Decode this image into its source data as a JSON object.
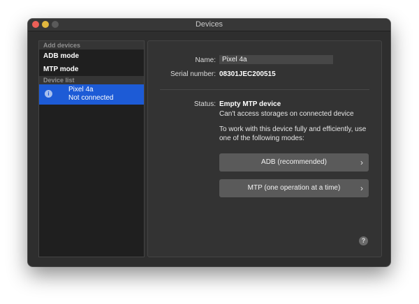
{
  "window": {
    "title": "Devices"
  },
  "sidebar": {
    "add_header": "Add devices",
    "modes": [
      {
        "label": "ADB mode"
      },
      {
        "label": "MTP mode"
      }
    ],
    "list_header": "Device list",
    "devices": [
      {
        "name": "Pixel 4a",
        "status": "Not connected",
        "icon": "info-icon"
      }
    ]
  },
  "detail": {
    "name_label": "Name:",
    "name_value": "Pixel 4a",
    "serial_label": "Serial number:",
    "serial_value": "08301JEC200515",
    "status_label": "Status:",
    "status_value": "Empty MTP device",
    "status_detail": "Can't access storages on connected device",
    "status_help": "To work with this device fully and efficiently, use one of the following modes:",
    "buttons": [
      {
        "label": "ADB (recommended)"
      },
      {
        "label": "MTP (one operation at a time)"
      }
    ],
    "help_glyph": "?"
  },
  "colors": {
    "selection": "#1d5bd6",
    "close": "#ec5f57",
    "minimize": "#e1b73e"
  }
}
